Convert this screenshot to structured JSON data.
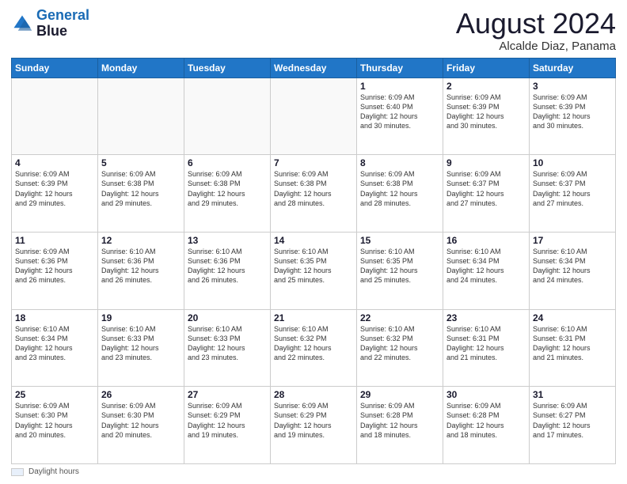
{
  "header": {
    "logo_line1": "General",
    "logo_line2": "Blue",
    "month_title": "August 2024",
    "subtitle": "Alcalde Diaz, Panama"
  },
  "days_of_week": [
    "Sunday",
    "Monday",
    "Tuesday",
    "Wednesday",
    "Thursday",
    "Friday",
    "Saturday"
  ],
  "weeks": [
    [
      {
        "day": "",
        "info": ""
      },
      {
        "day": "",
        "info": ""
      },
      {
        "day": "",
        "info": ""
      },
      {
        "day": "",
        "info": ""
      },
      {
        "day": "1",
        "info": "Sunrise: 6:09 AM\nSunset: 6:40 PM\nDaylight: 12 hours\nand 30 minutes."
      },
      {
        "day": "2",
        "info": "Sunrise: 6:09 AM\nSunset: 6:39 PM\nDaylight: 12 hours\nand 30 minutes."
      },
      {
        "day": "3",
        "info": "Sunrise: 6:09 AM\nSunset: 6:39 PM\nDaylight: 12 hours\nand 30 minutes."
      }
    ],
    [
      {
        "day": "4",
        "info": "Sunrise: 6:09 AM\nSunset: 6:39 PM\nDaylight: 12 hours\nand 29 minutes."
      },
      {
        "day": "5",
        "info": "Sunrise: 6:09 AM\nSunset: 6:38 PM\nDaylight: 12 hours\nand 29 minutes."
      },
      {
        "day": "6",
        "info": "Sunrise: 6:09 AM\nSunset: 6:38 PM\nDaylight: 12 hours\nand 29 minutes."
      },
      {
        "day": "7",
        "info": "Sunrise: 6:09 AM\nSunset: 6:38 PM\nDaylight: 12 hours\nand 28 minutes."
      },
      {
        "day": "8",
        "info": "Sunrise: 6:09 AM\nSunset: 6:38 PM\nDaylight: 12 hours\nand 28 minutes."
      },
      {
        "day": "9",
        "info": "Sunrise: 6:09 AM\nSunset: 6:37 PM\nDaylight: 12 hours\nand 27 minutes."
      },
      {
        "day": "10",
        "info": "Sunrise: 6:09 AM\nSunset: 6:37 PM\nDaylight: 12 hours\nand 27 minutes."
      }
    ],
    [
      {
        "day": "11",
        "info": "Sunrise: 6:09 AM\nSunset: 6:36 PM\nDaylight: 12 hours\nand 26 minutes."
      },
      {
        "day": "12",
        "info": "Sunrise: 6:10 AM\nSunset: 6:36 PM\nDaylight: 12 hours\nand 26 minutes."
      },
      {
        "day": "13",
        "info": "Sunrise: 6:10 AM\nSunset: 6:36 PM\nDaylight: 12 hours\nand 26 minutes."
      },
      {
        "day": "14",
        "info": "Sunrise: 6:10 AM\nSunset: 6:35 PM\nDaylight: 12 hours\nand 25 minutes."
      },
      {
        "day": "15",
        "info": "Sunrise: 6:10 AM\nSunset: 6:35 PM\nDaylight: 12 hours\nand 25 minutes."
      },
      {
        "day": "16",
        "info": "Sunrise: 6:10 AM\nSunset: 6:34 PM\nDaylight: 12 hours\nand 24 minutes."
      },
      {
        "day": "17",
        "info": "Sunrise: 6:10 AM\nSunset: 6:34 PM\nDaylight: 12 hours\nand 24 minutes."
      }
    ],
    [
      {
        "day": "18",
        "info": "Sunrise: 6:10 AM\nSunset: 6:34 PM\nDaylight: 12 hours\nand 23 minutes."
      },
      {
        "day": "19",
        "info": "Sunrise: 6:10 AM\nSunset: 6:33 PM\nDaylight: 12 hours\nand 23 minutes."
      },
      {
        "day": "20",
        "info": "Sunrise: 6:10 AM\nSunset: 6:33 PM\nDaylight: 12 hours\nand 23 minutes."
      },
      {
        "day": "21",
        "info": "Sunrise: 6:10 AM\nSunset: 6:32 PM\nDaylight: 12 hours\nand 22 minutes."
      },
      {
        "day": "22",
        "info": "Sunrise: 6:10 AM\nSunset: 6:32 PM\nDaylight: 12 hours\nand 22 minutes."
      },
      {
        "day": "23",
        "info": "Sunrise: 6:10 AM\nSunset: 6:31 PM\nDaylight: 12 hours\nand 21 minutes."
      },
      {
        "day": "24",
        "info": "Sunrise: 6:10 AM\nSunset: 6:31 PM\nDaylight: 12 hours\nand 21 minutes."
      }
    ],
    [
      {
        "day": "25",
        "info": "Sunrise: 6:09 AM\nSunset: 6:30 PM\nDaylight: 12 hours\nand 20 minutes."
      },
      {
        "day": "26",
        "info": "Sunrise: 6:09 AM\nSunset: 6:30 PM\nDaylight: 12 hours\nand 20 minutes."
      },
      {
        "day": "27",
        "info": "Sunrise: 6:09 AM\nSunset: 6:29 PM\nDaylight: 12 hours\nand 19 minutes."
      },
      {
        "day": "28",
        "info": "Sunrise: 6:09 AM\nSunset: 6:29 PM\nDaylight: 12 hours\nand 19 minutes."
      },
      {
        "day": "29",
        "info": "Sunrise: 6:09 AM\nSunset: 6:28 PM\nDaylight: 12 hours\nand 18 minutes."
      },
      {
        "day": "30",
        "info": "Sunrise: 6:09 AM\nSunset: 6:28 PM\nDaylight: 12 hours\nand 18 minutes."
      },
      {
        "day": "31",
        "info": "Sunrise: 6:09 AM\nSunset: 6:27 PM\nDaylight: 12 hours\nand 17 minutes."
      }
    ]
  ],
  "footer": {
    "legend_label": "Daylight hours"
  }
}
